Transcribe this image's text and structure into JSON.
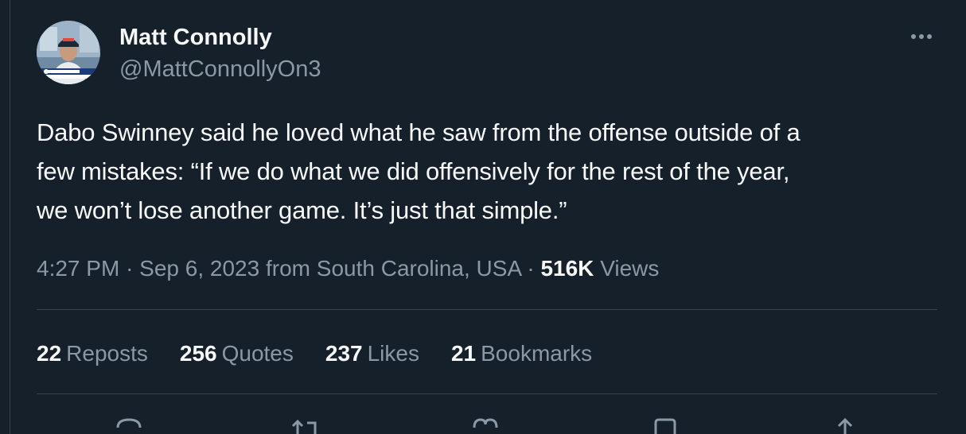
{
  "tweet": {
    "author": {
      "display_name": "Matt Connolly",
      "handle": "@MattConnollyOn3"
    },
    "text_lines": [
      "Dabo Swinney said he loved what he saw from the offense outside of a",
      "few mistakes: “If we do what we did offensively for the rest of the year,",
      "we won’t lose another game. It’s just that simple.”"
    ],
    "meta": {
      "time": "4:27 PM",
      "separator": "·",
      "date": "Sep 6, 2023",
      "from_label": "from",
      "location": "South Carolina, USA",
      "views_count": "516K",
      "views_label": "Views"
    },
    "stats": [
      {
        "count": "22",
        "label": "Reposts"
      },
      {
        "count": "256",
        "label": "Quotes"
      },
      {
        "count": "237",
        "label": "Likes"
      },
      {
        "count": "21",
        "label": "Bookmarks"
      }
    ],
    "actions": [
      "reply-icon",
      "repost-icon",
      "like-icon",
      "bookmark-icon",
      "share-icon"
    ],
    "colors": {
      "background": "#15202b",
      "primary_text": "#f7f9f9",
      "secondary_text": "#8b98a5",
      "border": "#38444d"
    }
  }
}
